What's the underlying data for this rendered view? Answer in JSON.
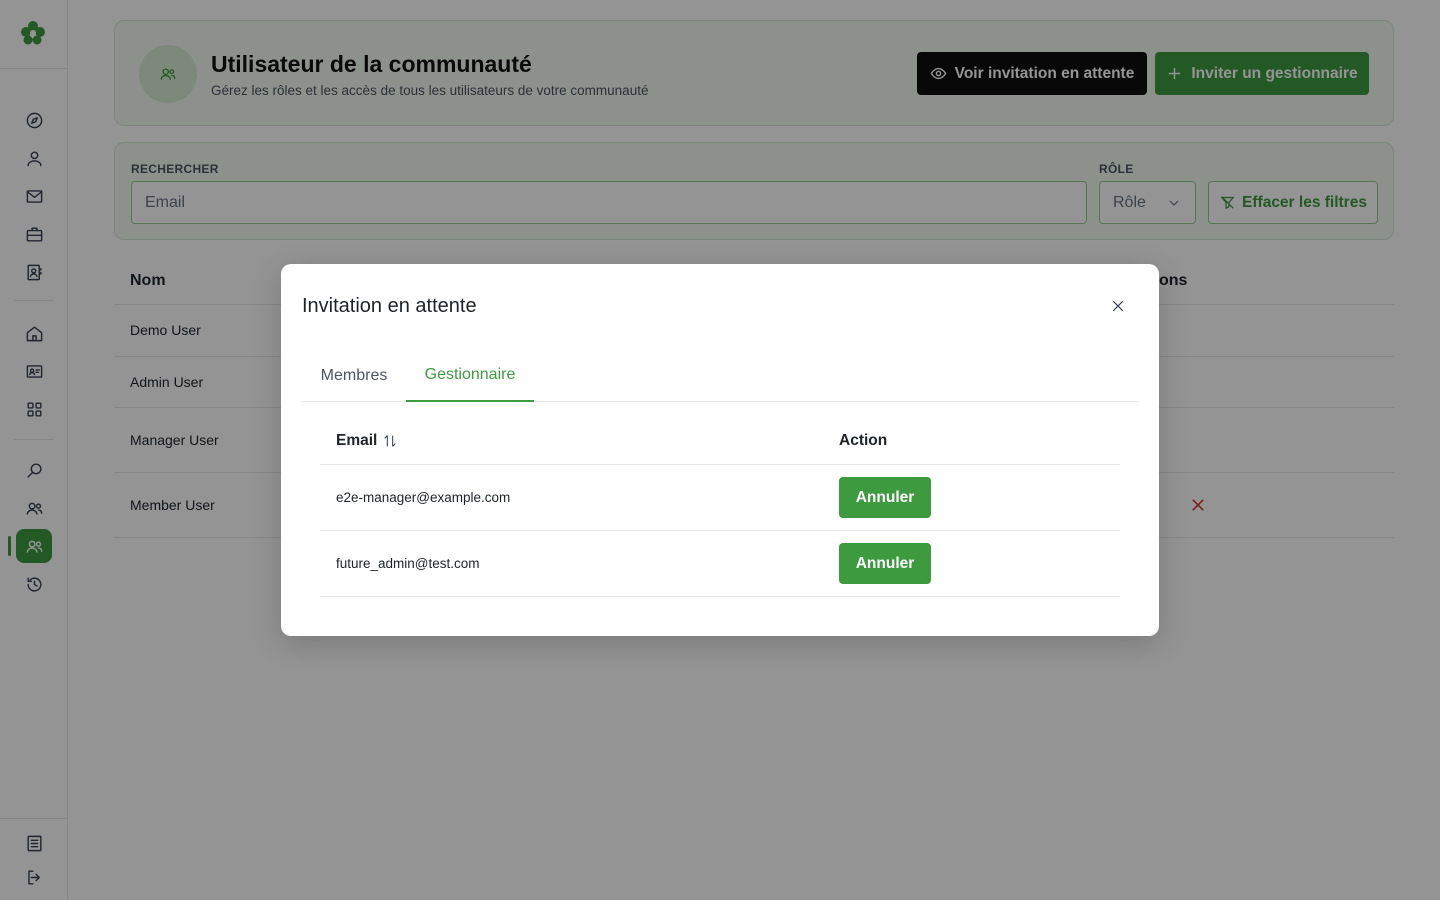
{
  "colors": {
    "accent": "#3d9a3f",
    "dark_button": "#0f0f0f",
    "danger": "#dc2626",
    "overlay": "rgba(0,0,0,0.42)"
  },
  "sidebar": {
    "logo_icon": "clover-logo",
    "items": [
      {
        "icon": "compass-icon",
        "active": false
      },
      {
        "icon": "user-icon",
        "active": false
      },
      {
        "icon": "mail-icon",
        "active": false
      },
      {
        "icon": "briefcase-icon",
        "active": false
      },
      {
        "icon": "contact-card-icon",
        "active": false
      },
      {
        "icon": "home-icon",
        "active": false
      },
      {
        "icon": "id-card-icon",
        "active": false
      },
      {
        "icon": "grid-icon",
        "active": false
      },
      {
        "icon": "search-icon",
        "active": false
      },
      {
        "icon": "users-icon",
        "active": false
      },
      {
        "icon": "community-users-icon",
        "active": true
      },
      {
        "icon": "history-icon",
        "active": false
      }
    ],
    "bottom_items": [
      {
        "icon": "document-icon"
      },
      {
        "icon": "logout-icon"
      }
    ]
  },
  "header": {
    "title": "Utilisateur de la communauté",
    "subtitle": "Gérez les rôles et les accès de tous les utilisateurs de votre communauté",
    "view_pending_label": "Voir invitation en attente",
    "invite_manager_label": "Inviter un gestionnaire"
  },
  "filters": {
    "search_label": "RECHERCHER",
    "search_placeholder": "Email",
    "role_label": "RÔLE",
    "role_value": "Rôle",
    "clear_label": "Effacer les filtres"
  },
  "users_table": {
    "columns": {
      "name": "Nom",
      "actions_partial": "ons"
    },
    "rows": [
      {
        "name": "Demo User"
      },
      {
        "name": "Admin User"
      },
      {
        "name": "Manager User"
      },
      {
        "name": "Member User"
      }
    ]
  },
  "modal": {
    "title": "Invitation en attente",
    "tabs": [
      {
        "label": "Membres",
        "active": false
      },
      {
        "label": "Gestionnaire",
        "active": true
      }
    ],
    "table": {
      "columns": {
        "email": "Email",
        "action": "Action"
      },
      "rows": [
        {
          "email": "e2e-manager@example.com",
          "action_label": "Annuler"
        },
        {
          "email": "future_admin@test.com",
          "action_label": "Annuler"
        }
      ]
    }
  }
}
